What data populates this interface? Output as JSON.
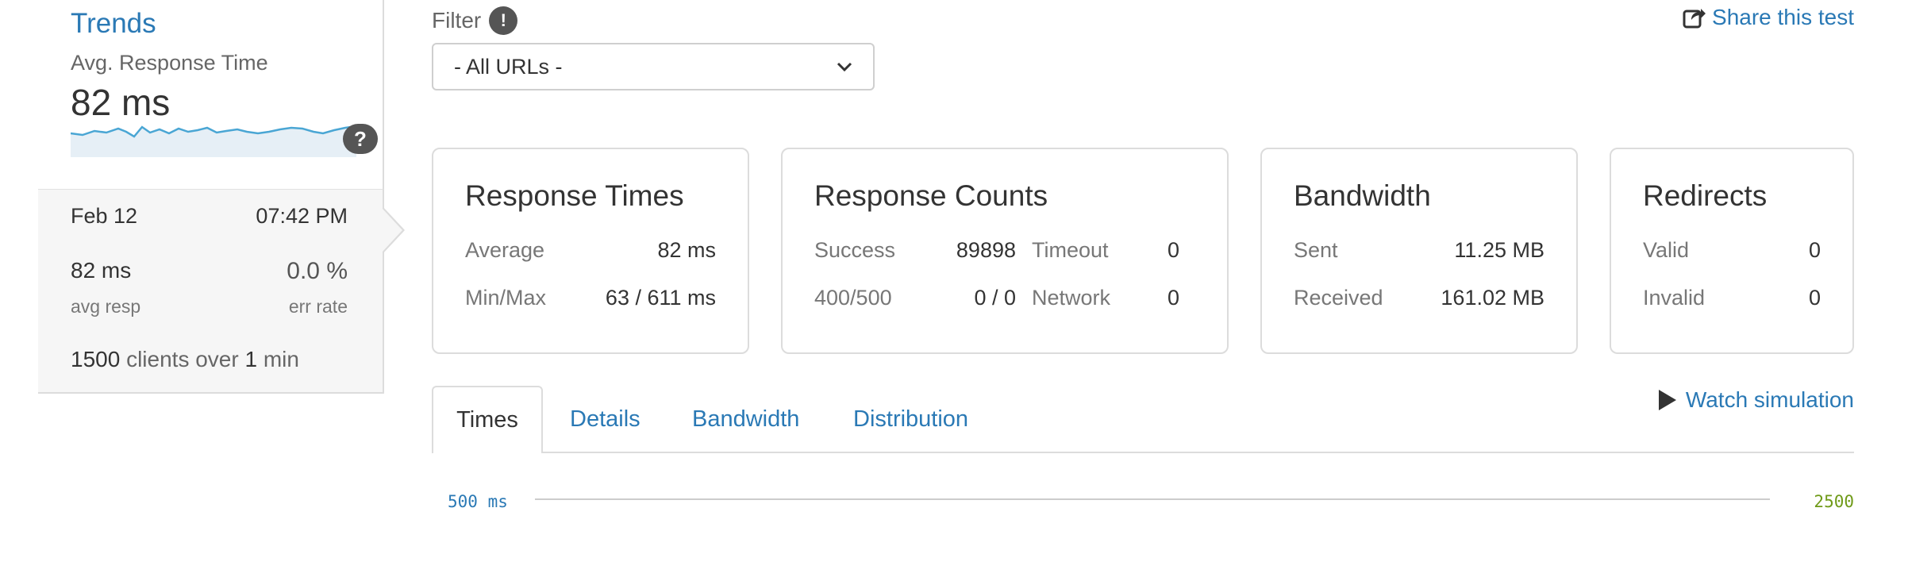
{
  "trends": {
    "title": "Trends",
    "subtitle": "Avg. Response Time",
    "value": "82 ms",
    "help_label": "?"
  },
  "run": {
    "date": "Feb 12",
    "time": "07:42 PM",
    "avg_resp": "82 ms",
    "avg_resp_label": "avg resp",
    "err_rate": "0.0 %",
    "err_rate_label": "err rate",
    "clients_count": "1500",
    "clients_mid": " clients over ",
    "duration_num": "1",
    "duration_unit": " min"
  },
  "filter": {
    "label": "Filter",
    "info_label": "!",
    "selected": "- All URLs -"
  },
  "share": {
    "label": "Share this test"
  },
  "cards": {
    "response_times": {
      "title": "Response Times",
      "rows": [
        {
          "label": "Average",
          "value": "82 ms"
        },
        {
          "label": "Min/Max",
          "value": "63 / 611 ms"
        }
      ]
    },
    "response_counts": {
      "title": "Response Counts",
      "rows": [
        {
          "label": "Success",
          "value": "89898",
          "label2": "Timeout",
          "value2": "0"
        },
        {
          "label": "400/500",
          "value": "0 / 0",
          "label2": "Network",
          "value2": "0"
        }
      ]
    },
    "bandwidth": {
      "title": "Bandwidth",
      "rows": [
        {
          "label": "Sent",
          "value": "11.25 MB"
        },
        {
          "label": "Received",
          "value": "161.02 MB"
        }
      ]
    },
    "redirects": {
      "title": "Redirects",
      "rows": [
        {
          "label": "Valid",
          "value": "0"
        },
        {
          "label": "Invalid",
          "value": "0"
        }
      ]
    }
  },
  "tabs": [
    {
      "label": "Times",
      "active": true
    },
    {
      "label": "Details",
      "active": false
    },
    {
      "label": "Bandwidth",
      "active": false
    },
    {
      "label": "Distribution",
      "active": false
    }
  ],
  "watch": {
    "label": "Watch simulation"
  },
  "chart": {
    "left_axis_label": "500 ms",
    "right_axis_label": "2500"
  },
  "colors": {
    "link": "#2a79b5",
    "right_axis": "#6f9a18",
    "sparkline_stroke": "#4aa6d4",
    "sparkline_fill": "#e6eff6"
  }
}
